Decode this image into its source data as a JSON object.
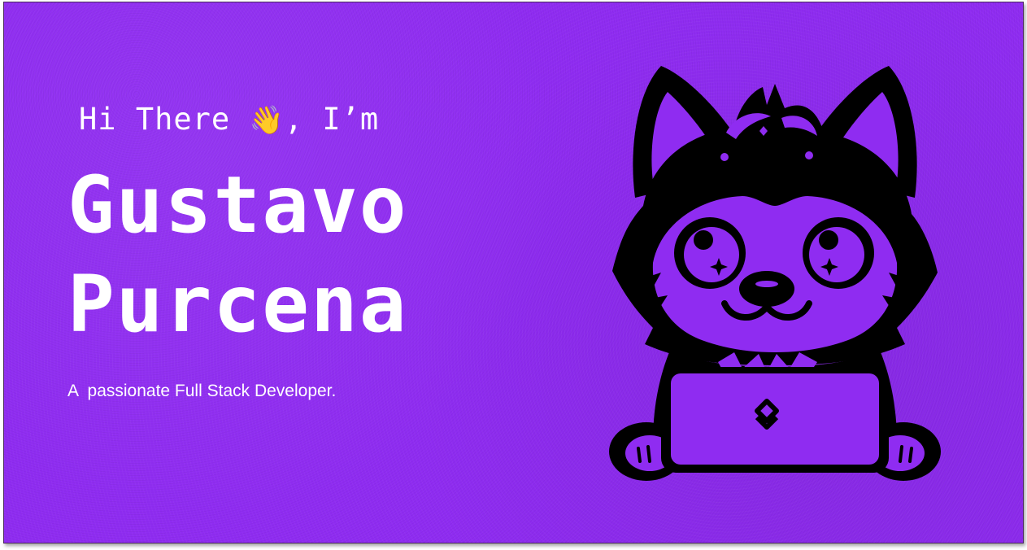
{
  "hero": {
    "greeting_prefix": "Hi There ",
    "greeting_emoji": "👋",
    "greeting_suffix": ", I’m",
    "first_name": "Gustavo",
    "last_name": "Purcena",
    "tagline": "A  passionate Full Stack Developer."
  },
  "theme": {
    "background": "#8f2cf1",
    "text": "#ffffff",
    "illustration_ink": "#000000"
  },
  "illustration": {
    "subject": "fox-mascot-with-laptop",
    "laptop_logo": "chevron-diamond-icon"
  }
}
